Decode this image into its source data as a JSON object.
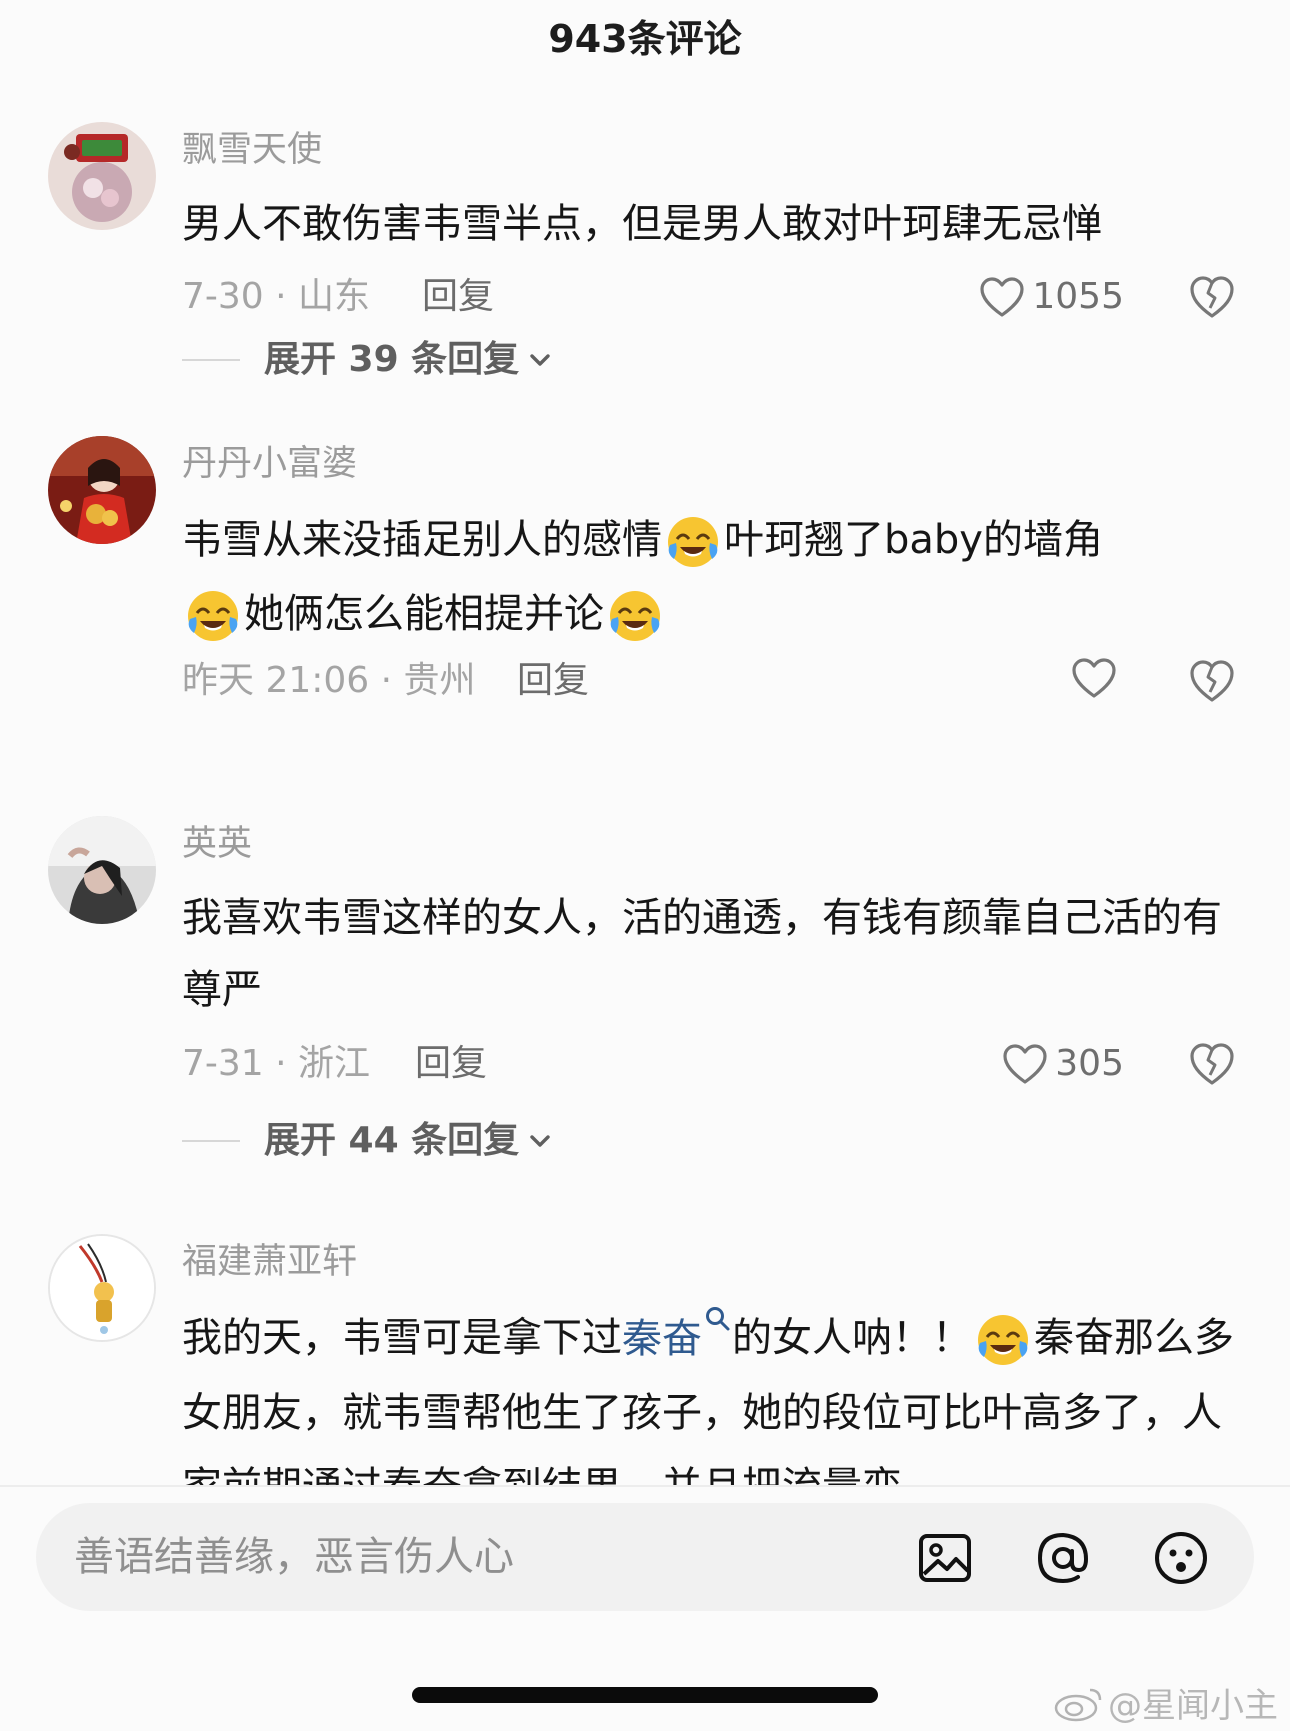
{
  "header": {
    "title": "943条评论"
  },
  "comments": [
    {
      "username": "飘雪天使",
      "text": "男人不敢伤害韦雪半点，但是男人敢对叶珂肆无忌惮",
      "date_location": "7-30 · 山东",
      "reply_label": "回复",
      "likes": "1055",
      "expand_label": "展开 39 条回复"
    },
    {
      "username": "丹丹小富婆",
      "text_part1": "韦雪从来没插足别人的感情",
      "text_part2": "叶珂翘了baby的墙角",
      "text_part3": "她俩怎么能相提并论",
      "date_location": "昨天 21:06 · 贵州",
      "reply_label": "回复",
      "likes": ""
    },
    {
      "username": "英英",
      "text": "我喜欢韦雪这样的女人，活的通透，有钱有颜靠自己活的有尊严",
      "date_location": "7-31 · 浙江",
      "reply_label": "回复",
      "likes": "305",
      "expand_label": "展开 44 条回复"
    },
    {
      "username": "福建萧亚轩",
      "text_part1": "我的天，韦雪可是拿下过",
      "link_text": "秦奋",
      "text_part2": "的女人呐！！",
      "text_part3": "秦奋那么多女朋友，就韦雪帮他生了孩子，她的段位可比叶高多了，人家前期通过秦奋拿到结果，并且把流量变"
    }
  ],
  "composer": {
    "placeholder": "善语结善缘，恶言伤人心"
  },
  "icons": [
    "image-icon",
    "at-icon",
    "emoji-icon",
    "heart-icon",
    "broken-heart-icon",
    "chevron-down-icon",
    "cry-laugh-emoji",
    "weibo-logo-icon"
  ],
  "watermark": {
    "text": "@星闻小主"
  },
  "colors": {
    "link": "#2f5a8f",
    "muted": "#9b9b9b",
    "text": "#161616"
  }
}
